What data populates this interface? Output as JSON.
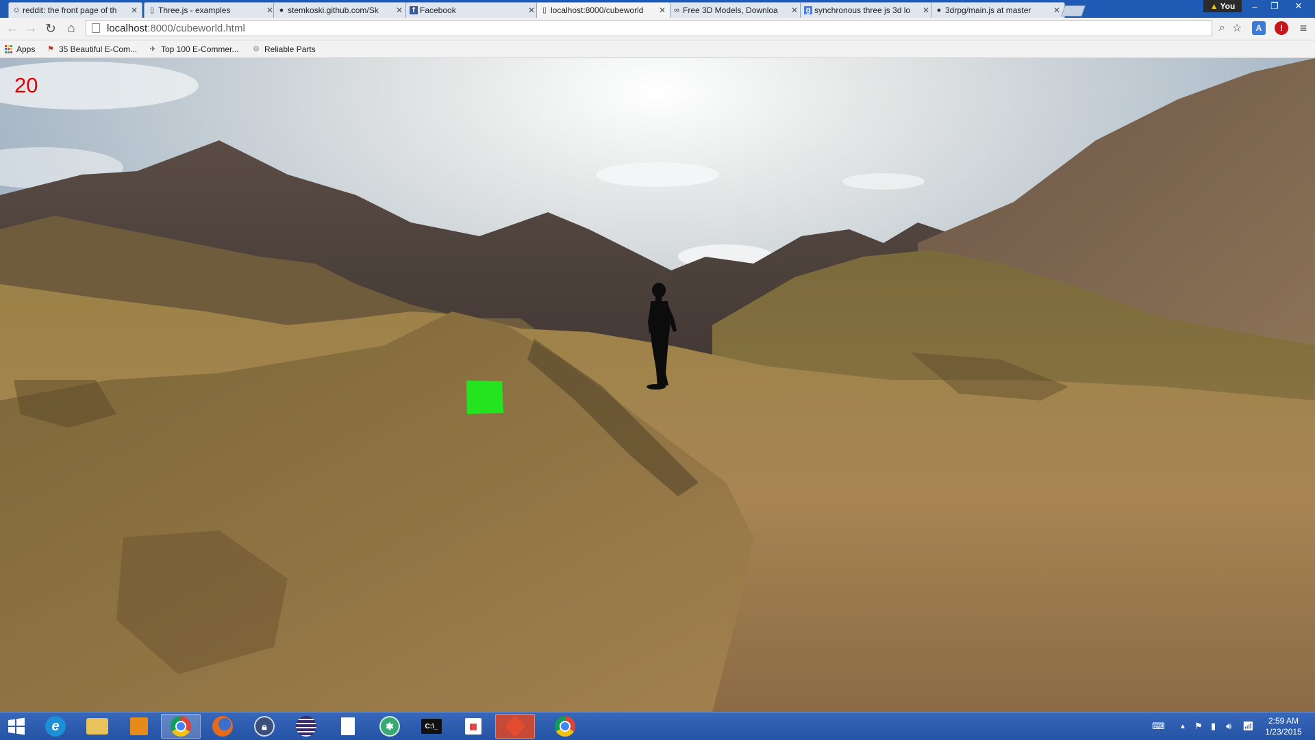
{
  "browser": {
    "tabs": [
      {
        "label": "reddit: the front page of th",
        "icon": "reddit-icon",
        "active": false
      },
      {
        "label": "Three.js - examples",
        "icon": "page-icon",
        "active": false
      },
      {
        "label": "stemkoski.github.com/Sk",
        "icon": "github-icon",
        "active": false
      },
      {
        "label": "Facebook",
        "icon": "facebook-icon",
        "active": false
      },
      {
        "label": "localhost:8000/cubeworld",
        "icon": "page-icon",
        "active": true
      },
      {
        "label": "Free 3D Models, Downloa",
        "icon": "link-icon",
        "active": false
      },
      {
        "label": "synchronous three js 3d lo",
        "icon": "google-icon",
        "active": false
      },
      {
        "label": "3drpg/main.js at master",
        "icon": "github-icon",
        "active": false
      }
    ],
    "profile": {
      "label": "You",
      "icon": "warning-icon"
    },
    "address": {
      "host": "localhost",
      "path": ":8000/cubeworld.html"
    },
    "bookmarks": [
      {
        "label": "Apps",
        "icon": "apps-grid-icon"
      },
      {
        "label": "35 Beautiful E-Com...",
        "icon": "bookmark-icon"
      },
      {
        "label": "Top 100 E-Commer...",
        "icon": "bookmark-icon"
      },
      {
        "label": "Reliable Parts",
        "icon": "bookmark-icon"
      }
    ],
    "close_glyph": "✕"
  },
  "scene": {
    "counter": "20",
    "cube_color": "#22e51f",
    "character_color": "#0c0c0c"
  },
  "taskbar": {
    "clock_time": "2:59 AM",
    "clock_date": "1/23/2015",
    "apps": [
      {
        "name": "start-button"
      },
      {
        "name": "internet-explorer-icon"
      },
      {
        "name": "file-explorer-icon"
      },
      {
        "name": "office-icon"
      },
      {
        "name": "chrome-icon"
      },
      {
        "name": "firefox-icon"
      },
      {
        "name": "lock-icon"
      },
      {
        "name": "eclipse-icon"
      },
      {
        "name": "document-icon"
      },
      {
        "name": "globe-app-icon"
      },
      {
        "name": "terminal-icon"
      },
      {
        "name": "grid-app-icon"
      },
      {
        "name": "git-icon"
      },
      {
        "name": "chrome-icon"
      }
    ]
  }
}
